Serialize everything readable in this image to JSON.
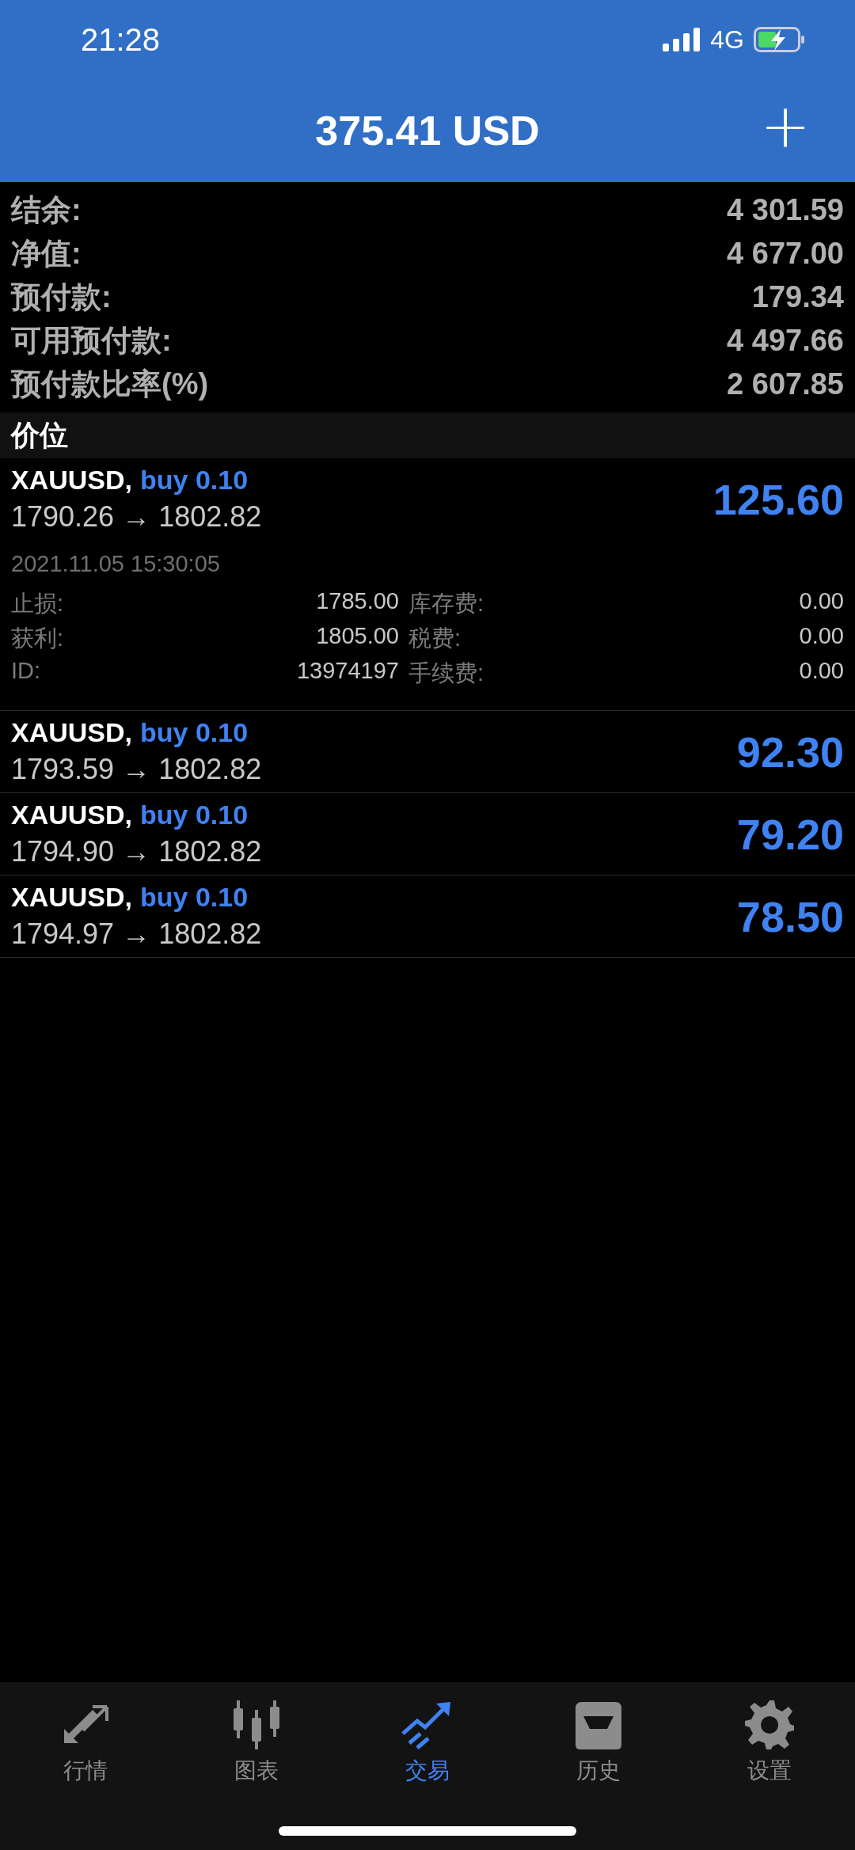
{
  "status_bar": {
    "time": "21:28",
    "network": "4G"
  },
  "header": {
    "title": "375.41 USD",
    "action": "+"
  },
  "summary": [
    {
      "label": "结余:",
      "value": "4 301.59"
    },
    {
      "label": "净值:",
      "value": "4 677.00"
    },
    {
      "label": "预付款:",
      "value": "179.34"
    },
    {
      "label": "可用预付款:",
      "value": "4 497.66"
    },
    {
      "label": "预付款比率(%)",
      "value": "2 607.85"
    }
  ],
  "section": {
    "title": "价位"
  },
  "positions": [
    {
      "symbol": "XAUUSD,",
      "order": "buy 0.10",
      "prices": "1790.26 → 1802.82",
      "profit": "125.60",
      "expanded": true,
      "time": "2021.11.05 15:30:05",
      "details": [
        {
          "label": "止损:",
          "value": "1785.00",
          "label2": "库存费:",
          "value2": "0.00"
        },
        {
          "label": "获利:",
          "value": "1805.00",
          "label2": "税费:",
          "value2": "0.00"
        },
        {
          "label": "ID:",
          "value": "13974197",
          "label2": "手续费:",
          "value2": "0.00"
        }
      ]
    },
    {
      "symbol": "XAUUSD,",
      "order": "buy 0.10",
      "prices": "1793.59 → 1802.82",
      "profit": "92.30",
      "expanded": false
    },
    {
      "symbol": "XAUUSD,",
      "order": "buy 0.10",
      "prices": "1794.90 → 1802.82",
      "profit": "79.20",
      "expanded": false
    },
    {
      "symbol": "XAUUSD,",
      "order": "buy 0.10",
      "prices": "1794.97 → 1802.82",
      "profit": "78.50",
      "expanded": false
    }
  ],
  "tabs": [
    {
      "kind": "quotes",
      "label": "行情",
      "selected": false
    },
    {
      "kind": "chart",
      "label": "图表",
      "selected": false
    },
    {
      "kind": "trade",
      "label": "交易",
      "selected": true
    },
    {
      "kind": "history",
      "label": "历史",
      "selected": false
    },
    {
      "kind": "settings",
      "label": "设置",
      "selected": false
    }
  ]
}
